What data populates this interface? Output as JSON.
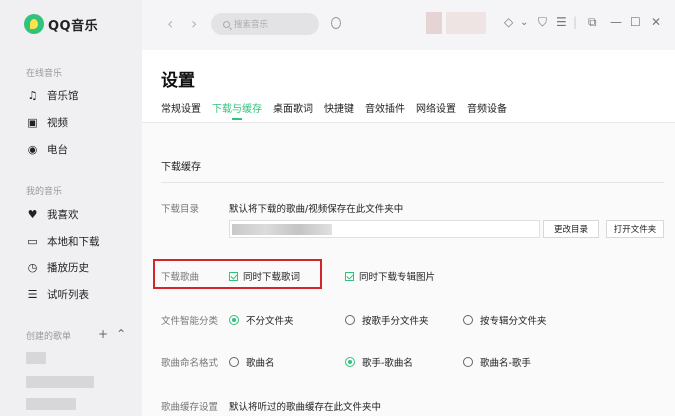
{
  "app": {
    "name": "QQ音乐"
  },
  "sidebar": {
    "online_section": "在线音乐",
    "online_items": [
      {
        "label": "音乐馆",
        "icon": "music-note-icon"
      },
      {
        "label": "视频",
        "icon": "video-icon"
      },
      {
        "label": "电台",
        "icon": "radio-icon"
      }
    ],
    "my_section": "我的音乐",
    "my_items": [
      {
        "label": "我喜欢",
        "icon": "heart-icon"
      },
      {
        "label": "本地和下载",
        "icon": "monitor-icon"
      },
      {
        "label": "播放历史",
        "icon": "history-icon"
      },
      {
        "label": "试听列表",
        "icon": "playlist-icon"
      }
    ],
    "created_section": "创建的歌单"
  },
  "topbar": {
    "search_placeholder": "搜索音乐"
  },
  "page": {
    "title": "设置",
    "tabs": [
      {
        "label": "常规设置",
        "active": false
      },
      {
        "label": "下载与缓存",
        "active": true
      },
      {
        "label": "桌面歌词",
        "active": false
      },
      {
        "label": "快捷键",
        "active": false
      },
      {
        "label": "音效插件",
        "active": false
      },
      {
        "label": "网络设置",
        "active": false
      },
      {
        "label": "音频设备",
        "active": false
      }
    ]
  },
  "settings": {
    "section_title": "下载缓存",
    "download_dir": {
      "label": "下载目录",
      "desc": "默认将下载的歌曲/视频保存在此文件夹中",
      "change_btn": "更改目录",
      "open_btn": "打开文件夹"
    },
    "download_song": {
      "label": "下载歌曲",
      "opt_lyrics": "同时下载歌词",
      "opt_lyrics_checked": true,
      "opt_cover": "同时下载专辑图片",
      "opt_cover_checked": true
    },
    "smart_category": {
      "label": "文件智能分类",
      "options": [
        "不分文件夹",
        "按歌手分文件夹",
        "按专辑分文件夹"
      ],
      "selected": 0
    },
    "naming_format": {
      "label": "歌曲命名格式",
      "options": [
        "歌曲名",
        "歌手-歌曲名",
        "歌曲名-歌手"
      ],
      "selected": 1
    },
    "cache": {
      "label": "歌曲缓存设置",
      "desc": "默认将听过的歌曲缓存在此文件夹中"
    }
  },
  "colors": {
    "accent": "#31c27c",
    "highlight": "#d2262a"
  }
}
